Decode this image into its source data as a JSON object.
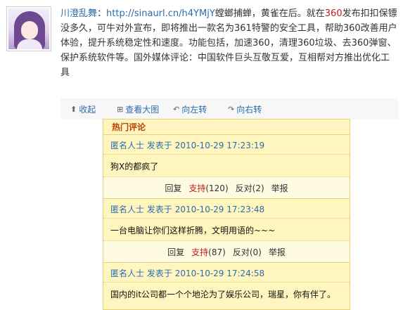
{
  "post": {
    "author": "川澄乱舞",
    "colon": "：",
    "link": "http://sinaurl.cn/h4YMjY",
    "text_a": "螳螂捕蝉，黄雀在后。就在",
    "highlight": "360",
    "text_b": "发布扣扣保镖没多久，可牛对外宣布，即将推出一款名为361特警的安全工具，帮助360改善用户体验，提升系统稳定性和速度。功能包括，加速360，清理360垃圾、去360弹窗、保护系统软件等。国外媒体评论：中国软件巨头互敬互爱，互相帮对方推出优化工具"
  },
  "toolbar": {
    "collapse": "收起",
    "view_large": "查看大图",
    "rotate_left": "向左转",
    "rotate_right": "向右转"
  },
  "comments": {
    "title": "热门评论",
    "items": [
      {
        "user": "匿名人士",
        "posted_label": "发表于",
        "time": "2010-10-29 17:23:19",
        "text": "狗X的都疯了",
        "reply": "回复",
        "support": "支持",
        "support_count": "(120)",
        "oppose": "反对",
        "oppose_count": "(2)",
        "report": "举报"
      },
      {
        "user": "匿名人士",
        "posted_label": "发表于",
        "time": "2010-10-29 17:23:48",
        "text": "一台电脑让你们这样折腾，文明用语的~~~",
        "reply": "回复",
        "support": "支持",
        "support_count": "(87)",
        "oppose": "反对",
        "oppose_count": "(0)",
        "report": "举报"
      },
      {
        "user": "匿名人士",
        "posted_label": "发表于",
        "time": "2010-10-29 17:24:58",
        "text": "国内的it公司都一个个地沦为了娱乐公司，瑞星，你有伴了。"
      }
    ]
  }
}
